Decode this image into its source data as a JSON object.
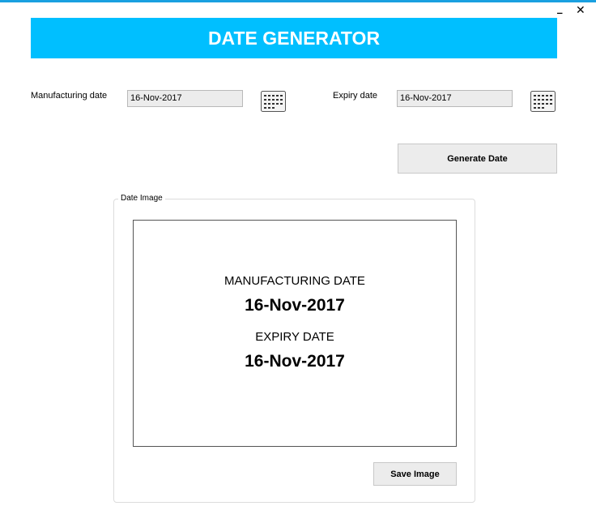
{
  "window": {
    "minimize_glyph": "‗",
    "close_glyph": "✕"
  },
  "header": {
    "title": "DATE GENERATOR"
  },
  "form": {
    "manufacturing_label": "Manufacturing date",
    "manufacturing_value": "16-Nov-2017",
    "expiry_label": "Expiry date",
    "expiry_value": "16-Nov-2017",
    "calendar_icon": "calendar-icon",
    "generate_button": "Generate Date"
  },
  "date_image": {
    "group_title": "Date Image",
    "manufacturing_heading": "MANUFACTURING DATE",
    "manufacturing_date": "16-Nov-2017",
    "expiry_heading": "EXPIRY DATE",
    "expiry_date": "16-Nov-2017",
    "save_button": "Save Image"
  },
  "colors": {
    "banner": "#00bfff",
    "border_accent": "#1aa0e0",
    "field_bg": "#ececec"
  }
}
